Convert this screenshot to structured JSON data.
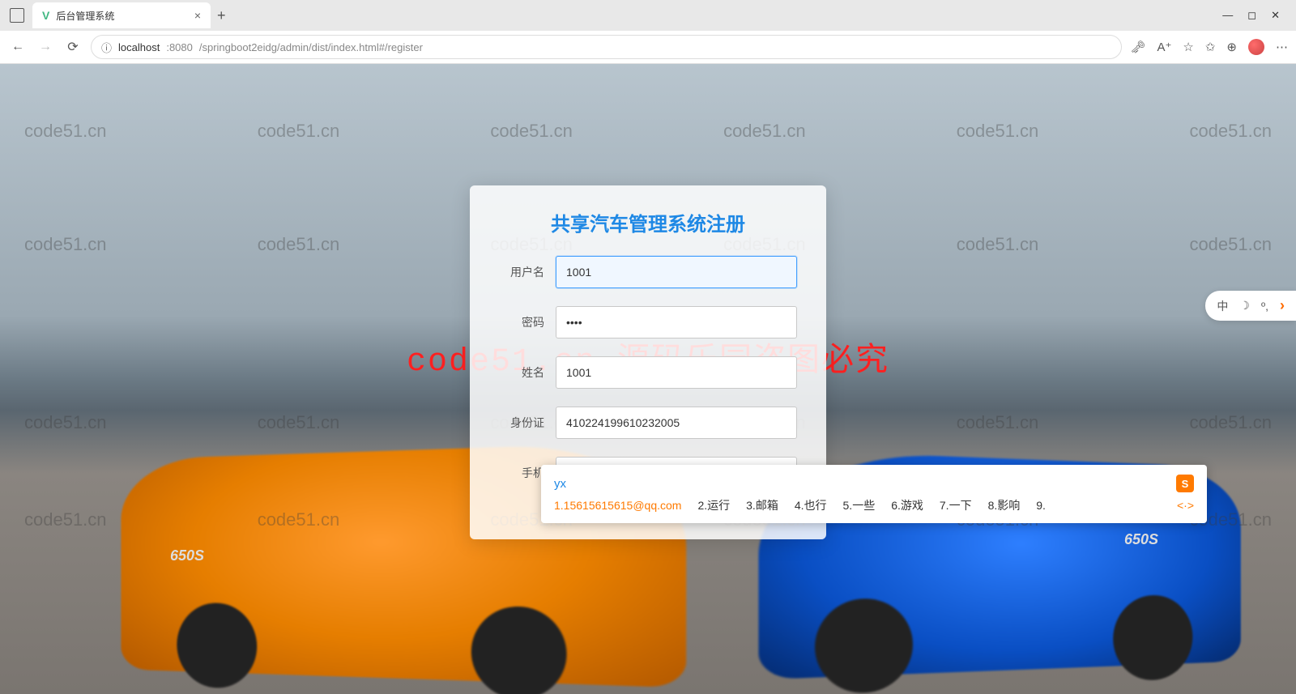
{
  "browser": {
    "tab_title": "后台管理系统",
    "url_host": "localhost",
    "url_port": ":8080",
    "url_path": "/springboot2eidg/admin/dist/index.html#/register"
  },
  "watermark": {
    "text": "code51.cn",
    "big_text": "code51.cn-源码乐园盗图必究"
  },
  "card": {
    "title": "共享汽车管理系统注册",
    "fields": {
      "username": {
        "label": "用户名",
        "value": "1001"
      },
      "password": {
        "label": "密码",
        "value": "••••"
      },
      "realname": {
        "label": "姓名",
        "value": "1001"
      },
      "idcard": {
        "label": "身份证",
        "value": "410224199610232005"
      },
      "phone": {
        "label": "手机",
        "value": "yx"
      }
    }
  },
  "ime": {
    "typed": "yx",
    "logo": "S",
    "candidates": [
      "1.15615615615@qq.com",
      "2.运行",
      "3.邮箱",
      "4.也行",
      "5.一些",
      "6.游戏",
      "7.一下",
      "8.影响",
      "9."
    ]
  },
  "float_tools": {
    "lang": "中",
    "moon": "☽",
    "punct": "º,"
  },
  "car_badge": "650S"
}
